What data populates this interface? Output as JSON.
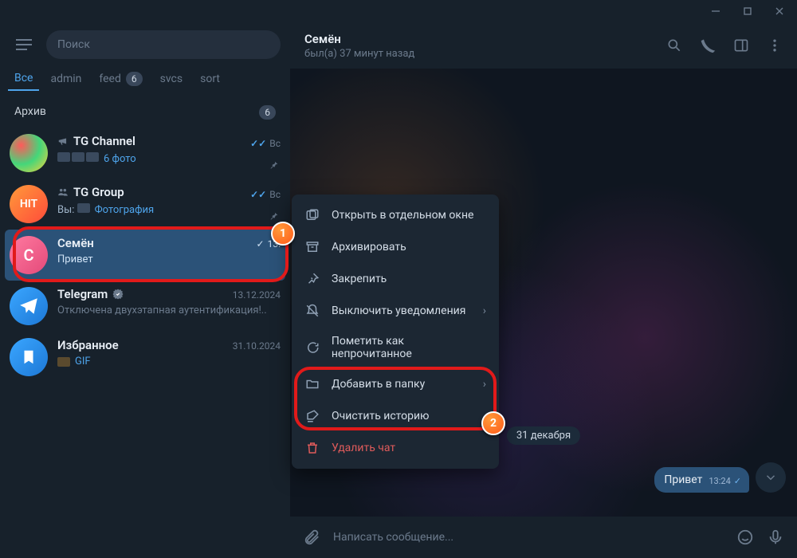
{
  "search": {
    "placeholder": "Поиск"
  },
  "folders": [
    {
      "label": "Все",
      "active": true
    },
    {
      "label": "admin"
    },
    {
      "label": "feed",
      "badge": "6"
    },
    {
      "label": "svcs"
    },
    {
      "label": "sort"
    }
  ],
  "archive": {
    "label": "Архив",
    "badge": "6"
  },
  "chats": [
    {
      "id": "tg-channel",
      "name": "TG Channel",
      "subtitle": "6 фото",
      "time": "Вс",
      "read": true,
      "pinned": true,
      "icon": "megaphone"
    },
    {
      "id": "tg-group",
      "name": "TG Group",
      "prefix": "Вы:",
      "subtitle": "Фотография",
      "time": "Вс",
      "read": true,
      "pinned": true,
      "icon": "group"
    },
    {
      "id": "semen",
      "name": "Семён",
      "subtitle": "Привет",
      "time": "13:",
      "read": true,
      "selected": true
    },
    {
      "id": "telegram",
      "name": "Telegram",
      "subtitle": "Отключена двухэтапная аутентификация!..",
      "time": "13.12.2024",
      "verified": true
    },
    {
      "id": "saved",
      "name": "Избранное",
      "subtitle": "GIF",
      "time": "31.10.2024"
    }
  ],
  "header": {
    "name": "Семён",
    "status": "был(а) 37 минут назад"
  },
  "context_menu": [
    {
      "id": "new-window",
      "label": "Открыть в отдельном окне"
    },
    {
      "id": "archive",
      "label": "Архивировать"
    },
    {
      "id": "pin",
      "label": "Закрепить"
    },
    {
      "id": "mute",
      "label": "Выключить уведомления",
      "submenu": true
    },
    {
      "id": "mark-unread",
      "label": "Пометить как непрочитанное"
    },
    {
      "id": "add-folder",
      "label": "Добавить в папку",
      "submenu": true
    },
    {
      "id": "clear-history",
      "label": "Очистить историю"
    },
    {
      "id": "delete-chat",
      "label": "Удалить чат",
      "danger": true
    }
  ],
  "conversation": {
    "date_pill": "31 декабря",
    "message": {
      "text": "Привет",
      "time": "13:24"
    }
  },
  "composer": {
    "placeholder": "Написать сообщение..."
  },
  "annotations": {
    "callout1": "1",
    "callout2": "2"
  }
}
